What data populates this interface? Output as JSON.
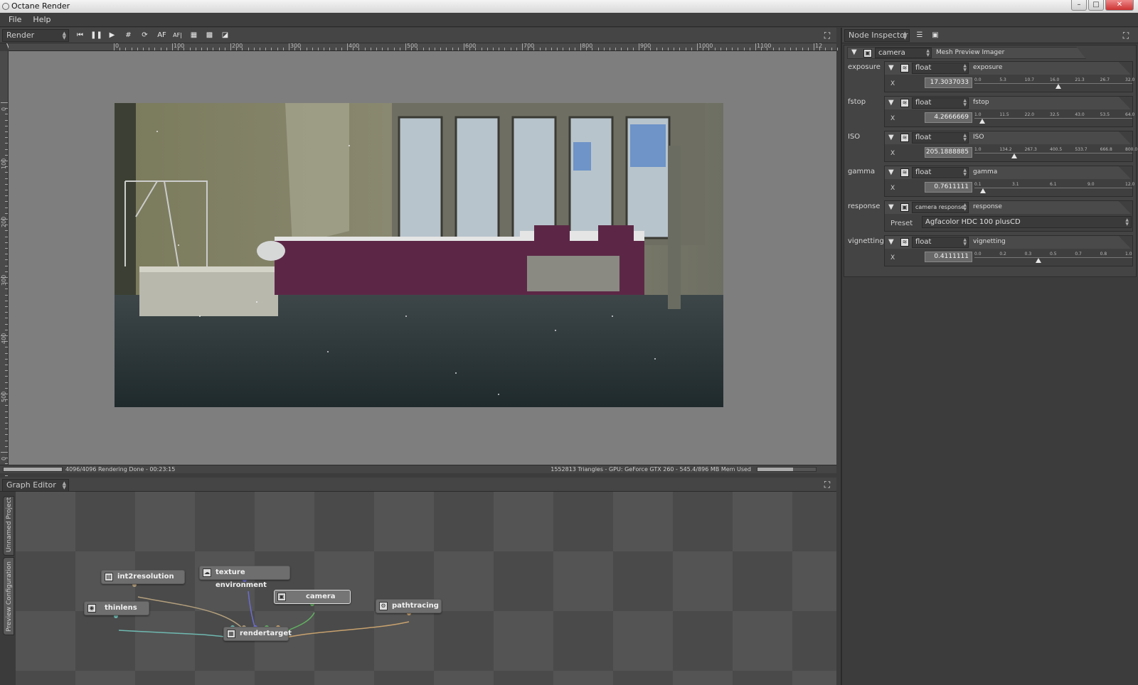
{
  "window": {
    "title": "Octane Render",
    "min": "–",
    "max": "□",
    "close": "✕"
  },
  "menu": [
    "File",
    "Help"
  ],
  "viewport_toolbar": {
    "selector": "Render Viewport",
    "buttons": [
      {
        "name": "skip-start-icon",
        "glyph": "⏮"
      },
      {
        "name": "pause-icon",
        "glyph": "❚❚"
      },
      {
        "name": "play-icon",
        "glyph": "▶"
      },
      {
        "name": "grid-icon",
        "glyph": "#"
      },
      {
        "name": "refresh-icon",
        "glyph": "⟳"
      },
      {
        "name": "autofocus-icon",
        "glyph": "AF"
      },
      {
        "name": "autofocus-point-icon",
        "glyph": "AF|"
      },
      {
        "name": "region-icon",
        "glyph": "▦"
      },
      {
        "name": "checker-icon",
        "glyph": "▩"
      },
      {
        "name": "tile-icon",
        "glyph": "◪"
      }
    ]
  },
  "ruler": {
    "h_labels": [
      "0",
      "100",
      "200",
      "300",
      "400",
      "500",
      "600",
      "700",
      "800",
      "900",
      "1000",
      "1100",
      "12"
    ],
    "v_labels": [
      "0",
      "100",
      "200",
      "300",
      "400",
      "500",
      "0"
    ]
  },
  "status": {
    "progress": 1.0,
    "left": "4096/4096 Rendering Done - 00:23:15",
    "right": "1552813 Triangles - GPU: GeForce GTX 260 - 545.4/896 MB Mem Used",
    "mem_fraction": 0.61
  },
  "graph_editor": {
    "title": "Graph Editor",
    "tabs": [
      "Unnamed Project",
      "Preview Configuration"
    ],
    "nodes": [
      {
        "id": "int2resolution",
        "label": "int2resolution"
      },
      {
        "id": "texture-environment",
        "label": "texture environment"
      },
      {
        "id": "camera",
        "label": "camera"
      },
      {
        "id": "pathtracing",
        "label": "pathtracing"
      },
      {
        "id": "thinlens",
        "label": "thinlens"
      },
      {
        "id": "rendertarget",
        "label": "rendertarget"
      }
    ]
  },
  "inspector": {
    "title": "Node Inspector",
    "node": {
      "name": "camera",
      "type": "Mesh Preview Imager"
    },
    "params": [
      {
        "label": "exposure",
        "type": "float",
        "name": "exposure",
        "axis": "X",
        "value": "17.3037033",
        "ticks": [
          "0.0",
          "5.3",
          "10.7",
          "16.0",
          "21.3",
          "26.7",
          "32.0"
        ],
        "fraction": 0.54
      },
      {
        "label": "fstop",
        "type": "float",
        "name": "fstop",
        "axis": "X",
        "value": "4.2666669",
        "ticks": [
          "1.0",
          "11.5",
          "22.0",
          "32.5",
          "43.0",
          "53.5",
          "64.0"
        ],
        "fraction": 0.052
      },
      {
        "label": "ISO",
        "type": "float",
        "name": "ISO",
        "axis": "X",
        "value": "205.1888885",
        "ticks": [
          "1.0",
          "134.2",
          "267.3",
          "400.5",
          "533.7",
          "666.8",
          "800.0"
        ],
        "fraction": 0.255
      },
      {
        "label": "gamma",
        "type": "float",
        "name": "gamma",
        "axis": "X",
        "value": "0.7611111",
        "ticks": [
          "0.1",
          "3.1",
          "6.1",
          "9.0",
          "12.0"
        ],
        "fraction": 0.055
      },
      {
        "label": "response",
        "type": "camera response",
        "name": "response",
        "preset_label": "Preset",
        "preset": "Agfacolor HDC 100 plusCD"
      },
      {
        "label": "vignetting",
        "type": "float",
        "name": "vignetting",
        "axis": "X",
        "value": "0.4111111",
        "ticks": [
          "0.0",
          "0.2",
          "0.3",
          "0.5",
          "0.7",
          "0.8",
          "1.0"
        ],
        "fraction": 0.411
      }
    ]
  }
}
